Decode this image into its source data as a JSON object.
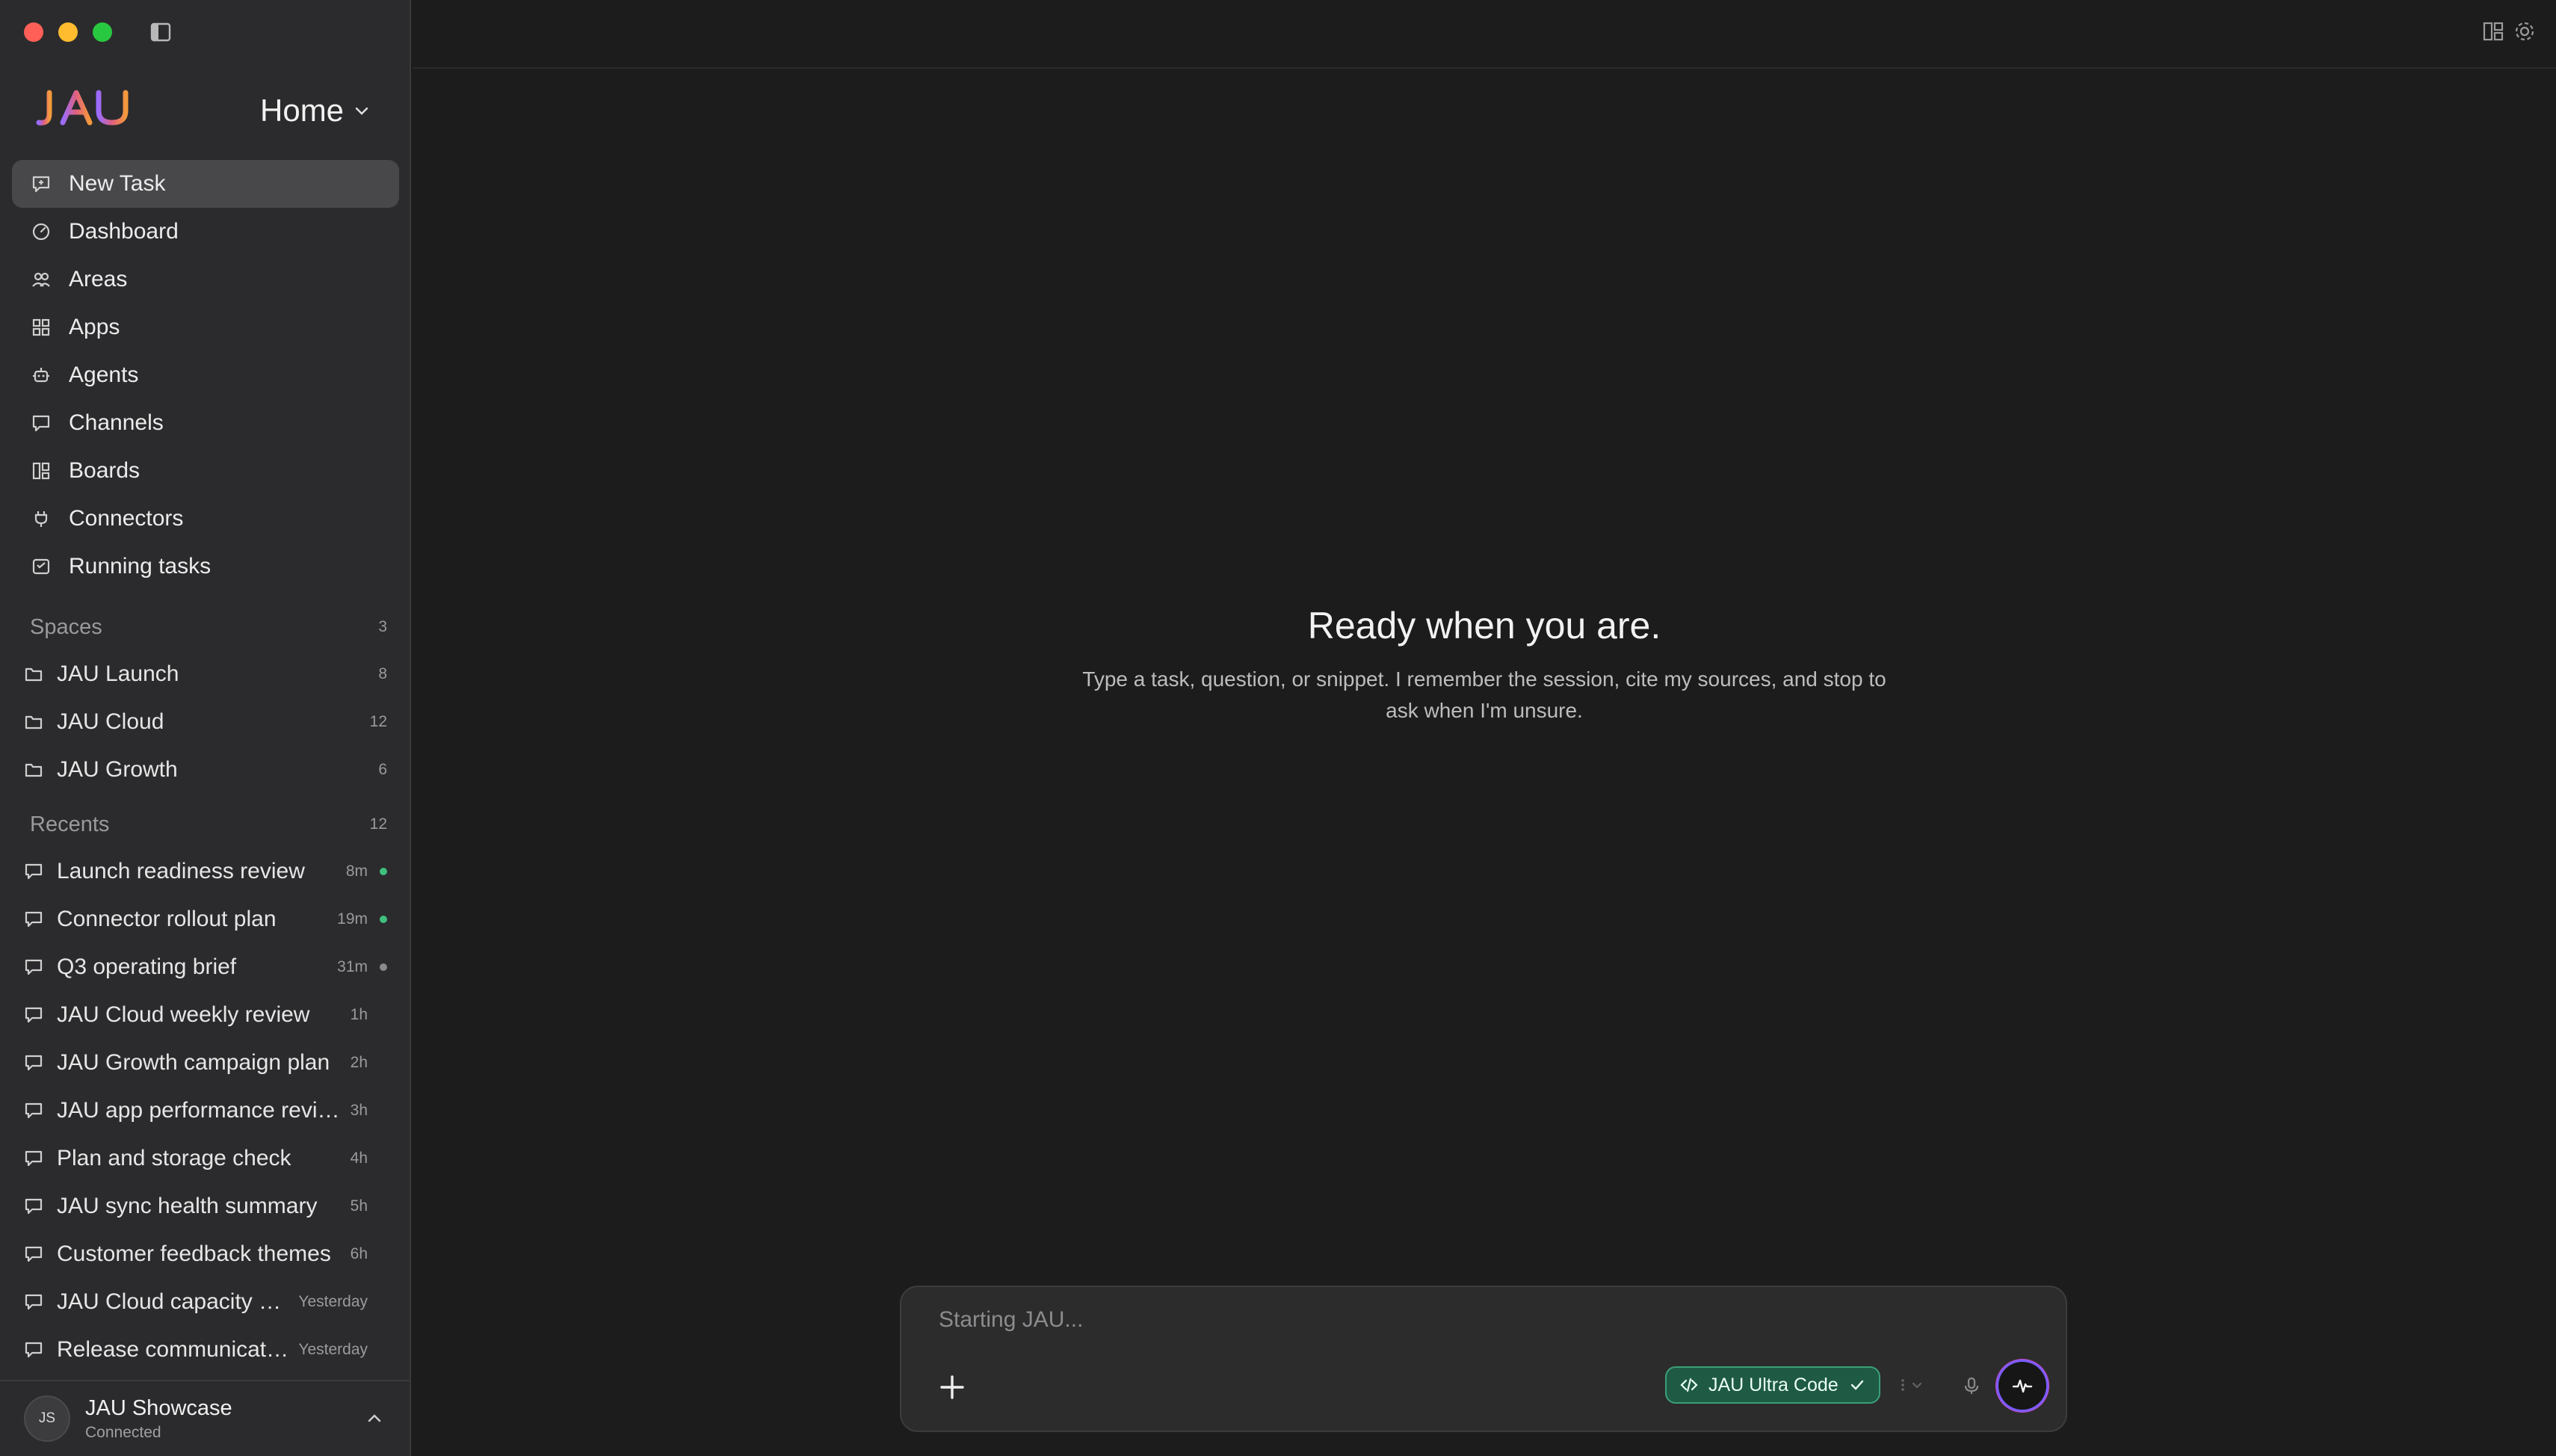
{
  "sidebar": {
    "workspace": "Home",
    "nav": [
      {
        "label": "New Task",
        "icon": "chat-plus-icon",
        "active": true
      },
      {
        "label": "Dashboard",
        "icon": "gauge-icon"
      },
      {
        "label": "Areas",
        "icon": "people-icon"
      },
      {
        "label": "Apps",
        "icon": "apps-icon"
      },
      {
        "label": "Agents",
        "icon": "robot-icon"
      },
      {
        "label": "Channels",
        "icon": "chat-icon"
      },
      {
        "label": "Boards",
        "icon": "board-icon"
      },
      {
        "label": "Connectors",
        "icon": "plug-icon"
      },
      {
        "label": "Running tasks",
        "icon": "tasks-icon"
      }
    ],
    "spaces": {
      "title": "Spaces",
      "count": "3",
      "items": [
        {
          "label": "JAU Launch",
          "count": "8"
        },
        {
          "label": "JAU Cloud",
          "count": "12"
        },
        {
          "label": "JAU Growth",
          "count": "6"
        }
      ]
    },
    "recents": {
      "title": "Recents",
      "count": "12",
      "items": [
        {
          "label": "Launch readiness review",
          "time": "8m",
          "status": "green"
        },
        {
          "label": "Connector rollout plan",
          "time": "19m",
          "status": "green"
        },
        {
          "label": "Q3 operating brief",
          "time": "31m",
          "status": "gray"
        },
        {
          "label": "JAU Cloud weekly review",
          "time": "1h",
          "status": ""
        },
        {
          "label": "JAU Growth campaign plan",
          "time": "2h",
          "status": ""
        },
        {
          "label": "JAU app performance review",
          "time": "3h",
          "status": ""
        },
        {
          "label": "Plan and storage check",
          "time": "4h",
          "status": ""
        },
        {
          "label": "JAU sync health summary",
          "time": "5h",
          "status": ""
        },
        {
          "label": "Customer feedback themes",
          "time": "6h",
          "status": ""
        },
        {
          "label": "JAU Cloud capacity plan",
          "time": "Yesterday",
          "status": ""
        },
        {
          "label": "Release communicatio...",
          "time": "Yesterday",
          "status": ""
        }
      ]
    },
    "account": {
      "initials": "JS",
      "name": "JAU Showcase",
      "status": "Connected"
    }
  },
  "main": {
    "title": "Ready when you are.",
    "subtitle": "Type a task, question, or snippet. I remember the session, cite my sources, and stop to ask when I'm unsure.",
    "composer": {
      "placeholder": "Starting JAU...",
      "model": "JAU Ultra Code"
    }
  },
  "colors": {
    "accent_green": "#1f5a44",
    "status_green": "#3fbf7f",
    "status_gray": "#8a8a8a",
    "sidebar_bg": "#2b2b2d",
    "main_bg": "#1c1c1c"
  }
}
